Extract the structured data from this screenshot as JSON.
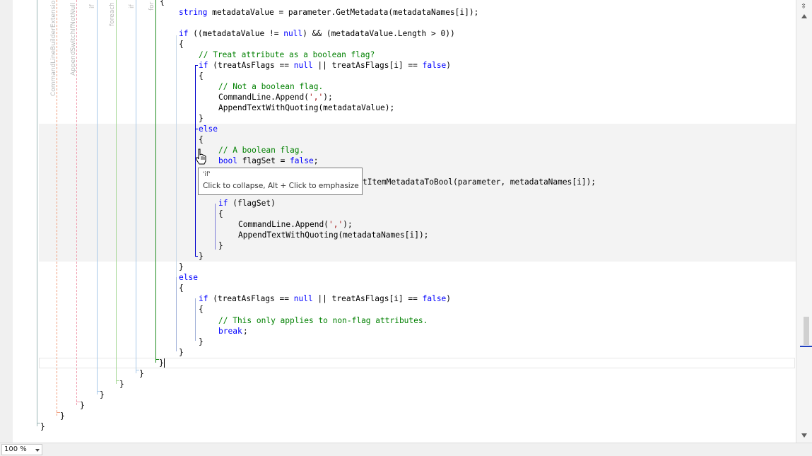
{
  "editor": {
    "scope_labels": {
      "extension": "CommandLineBuilderExtension",
      "append_switch": "AppendSwitchIfNotNull",
      "if_outer": "if",
      "foreach": "foreach",
      "if_inner": "if",
      "for": "for"
    },
    "lines": {
      "l1": {
        "kw": "string",
        "rest": " metadataValue = parameter.GetMetadata(metadataNames[i]);"
      },
      "l2": {
        "kw": "if",
        "rest": " ((metadataValue != ",
        "kw2": "null",
        "rest2": ") && (metadataValue.Length > 0))"
      },
      "l3": "{",
      "l4": "// Treat attribute as a boolean flag?",
      "l5": {
        "kw": "if",
        "rest": " (treatAsFlags == ",
        "kw2": "null",
        "rest2": " || treatAsFlags[i] == ",
        "kw3": "false",
        "rest3": ")"
      },
      "l6": "{",
      "l7": "// Not a boolean flag.",
      "l8": {
        "pre": "CommandLine.Append(",
        "str": "','",
        "post": ");"
      },
      "l9": "AppendTextWithQuoting(metadataValue);",
      "l10": "}",
      "l11": "else",
      "l12": "{",
      "l13": "// A boolean flag.",
      "l14": {
        "kw": "bool",
        "rest": " flagSet = ",
        "kw2": "false",
        "rest2": ";"
      },
      "l15": "tItemMetadataToBool(parameter, metadataNames[i]);",
      "l16": {
        "kw": "if",
        "rest": " (flagSet)"
      },
      "l17": "{",
      "l18": {
        "pre": "CommandLine.Append(",
        "str": "','",
        "post": ");"
      },
      "l19": "AppendTextWithQuoting(metadataNames[i]);",
      "l20": "}",
      "l21": "}",
      "l22": "}",
      "l23": "else",
      "l24": "{",
      "l25": {
        "kw": "if",
        "rest": " (treatAsFlags == ",
        "kw2": "null",
        "rest2": " || treatAsFlags[i] == ",
        "kw3": "false",
        "rest3": ")"
      },
      "l26": "{",
      "l27": "// This only applies to non-flag attributes.",
      "l28": {
        "kw": "break",
        "rest": ";"
      },
      "l29": "}",
      "l30": "}",
      "l31": "}",
      "c1": "}",
      "c2": "}",
      "c3": "}",
      "c4": "}",
      "c5": "}",
      "c6": "}"
    }
  },
  "tooltip": {
    "title": "'if'",
    "text": "Click to collapse, Alt + Click to emphasize"
  },
  "status": {
    "zoom": "100 %"
  },
  "icons": {
    "split": "split-editor-icon",
    "cursor": "hand-pointer-icon"
  },
  "colors": {
    "keyword": "#0000ff",
    "comment": "#008000",
    "string": "#a31515",
    "fold_guide": "#0000cc"
  }
}
